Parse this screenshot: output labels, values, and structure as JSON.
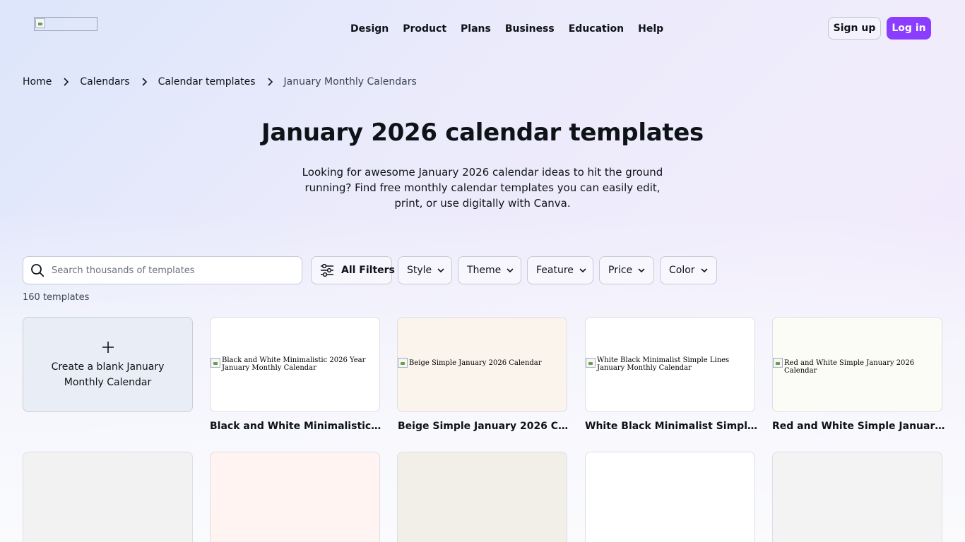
{
  "nav": {
    "items": [
      "Design",
      "Product",
      "Plans",
      "Business",
      "Education",
      "Help"
    ],
    "signup": "Sign up",
    "login": "Log in"
  },
  "breadcrumb": [
    "Home",
    "Calendars",
    "Calendar templates",
    "January Monthly Calendars"
  ],
  "page": {
    "title": "January 2026 calendar templates",
    "intro": "Looking for awesome January 2026 calendar ideas to hit the ground running? Find free monthly calendar templates you can easily edit, print, or use digitally with Canva."
  },
  "search": {
    "placeholder": "Search thousands of templates"
  },
  "filters": {
    "all": "All Filters",
    "items": [
      "Style",
      "Theme",
      "Feature",
      "Price",
      "Color"
    ]
  },
  "results_count": "160 templates",
  "blank_card": {
    "label": "Create a blank January Monthly Calendar"
  },
  "templates": [
    {
      "alt": "Black and White Minimalistic 2026 Year January Monthly Calendar",
      "title": "Black and White Minimalistic 2026 Year January Monthly Calendar",
      "bg": "#ffffff"
    },
    {
      "alt": "Beige Simple January 2026 Calendar",
      "title": "Beige Simple January 2026 Calendar",
      "bg": "#faf4ec"
    },
    {
      "alt": "White Black Minimalist Simple Lines January Monthly Calendar",
      "title": "White Black Minimalist Simple Lines January Monthly Calendar",
      "bg": "#ffffff"
    },
    {
      "alt": "Red and White Simple January 2026 Calendar",
      "title": "Red and White Simple January 2026 Calendar",
      "bg": "#fcfcf7"
    }
  ],
  "second_row_colors": [
    "#f2f2f2",
    "#fff4f1",
    "#f2efe9",
    "#ffffff",
    "#f3f3f3"
  ],
  "colors": {
    "accent": "#8b3dff",
    "text": "#0e1318"
  }
}
